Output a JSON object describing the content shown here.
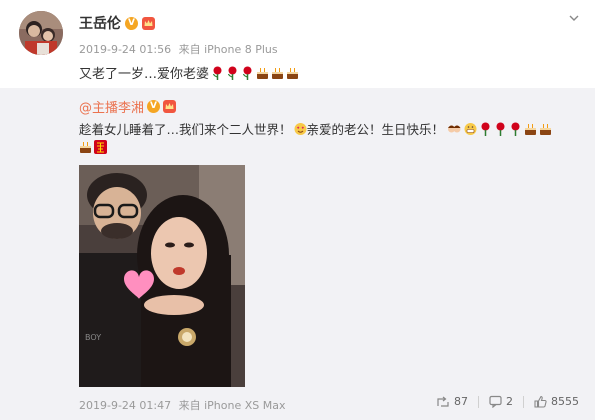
{
  "post": {
    "author": "王岳伦",
    "timestamp": "2019-9-24 01:56",
    "source": "来自 iPhone 8 Plus",
    "text": "又老了一岁…爱你老婆"
  },
  "repost": {
    "author": "@主播李湘",
    "text": "趁着女儿睡着了…我们来个二人世界！",
    "text_b": "亲爱的老公！生日快乐！",
    "timestamp": "2019-9-24 01:47",
    "source": "来自 iPhone XS Max",
    "stats": {
      "reposts": "87",
      "comments": "2",
      "likes": "8555"
    }
  },
  "colors": {
    "link": "#eb7350",
    "repost_bg": "#f2f2f5",
    "meta": "#9a9a9a",
    "verified": "#f5a623"
  },
  "icons": [
    "chevron-down-icon",
    "verified-icon",
    "crown-icon",
    "rose-emoji",
    "cake-emoji",
    "couple-emoji",
    "grin-emoji",
    "heart-eyes-emoji",
    "double-happiness-emoji",
    "repost-icon",
    "comment-icon",
    "like-icon"
  ]
}
